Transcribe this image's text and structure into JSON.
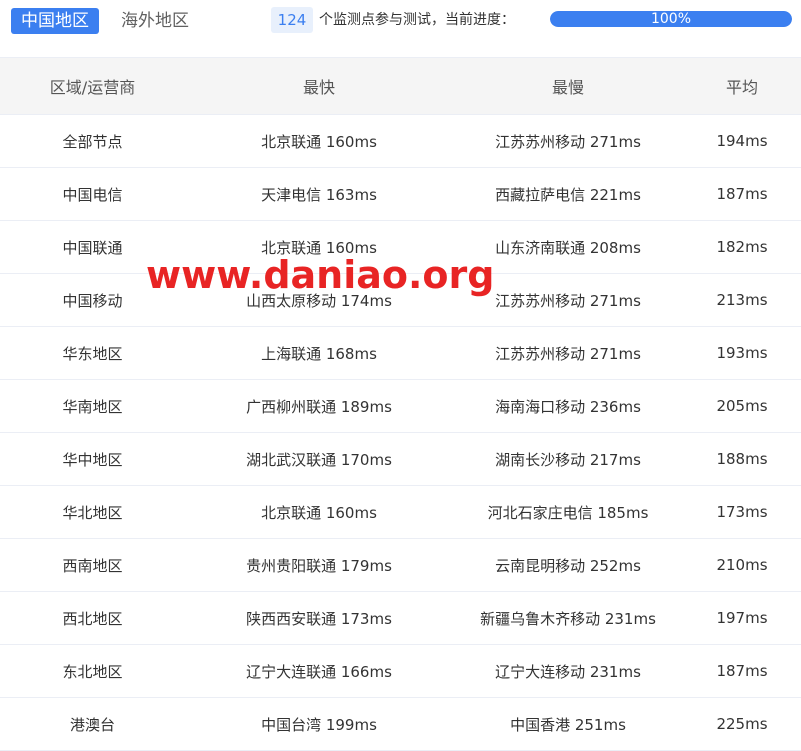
{
  "tabs": {
    "active_label": "中国地区",
    "inactive_label": "海外地区"
  },
  "status": {
    "count": "124",
    "text": "个监测点参与测试，当前进度：",
    "progress_label": "100%",
    "progress_fraction": 1.0
  },
  "table": {
    "headers": [
      "区域/运营商",
      "最快",
      "最慢",
      "平均"
    ],
    "rows": [
      [
        "全部节点",
        "北京联通 160ms",
        "江苏苏州移动 271ms",
        "194ms"
      ],
      [
        "中国电信",
        "天津电信 163ms",
        "西藏拉萨电信 221ms",
        "187ms"
      ],
      [
        "中国联通",
        "北京联通 160ms",
        "山东济南联通 208ms",
        "182ms"
      ],
      [
        "中国移动",
        "山西太原移动 174ms",
        "江苏苏州移动 271ms",
        "213ms"
      ],
      [
        "华东地区",
        "上海联通 168ms",
        "江苏苏州移动 271ms",
        "193ms"
      ],
      [
        "华南地区",
        "广西柳州联通 189ms",
        "海南海口移动 236ms",
        "205ms"
      ],
      [
        "华中地区",
        "湖北武汉联通 170ms",
        "湖南长沙移动 217ms",
        "188ms"
      ],
      [
        "华北地区",
        "北京联通 160ms",
        "河北石家庄电信 185ms",
        "173ms"
      ],
      [
        "西南地区",
        "贵州贵阳联通 179ms",
        "云南昆明移动 252ms",
        "210ms"
      ],
      [
        "西北地区",
        "陕西西安联通 173ms",
        "新疆乌鲁木齐移动 231ms",
        "197ms"
      ],
      [
        "东北地区",
        "辽宁大连联通 166ms",
        "辽宁大连移动 231ms",
        "187ms"
      ],
      [
        "港澳台",
        "中国台湾 199ms",
        "中国香港 251ms",
        "225ms"
      ]
    ]
  },
  "watermark": "www.daniao.org",
  "colors": {
    "accent": "#3b7ff0",
    "watermark": "#e82424"
  }
}
